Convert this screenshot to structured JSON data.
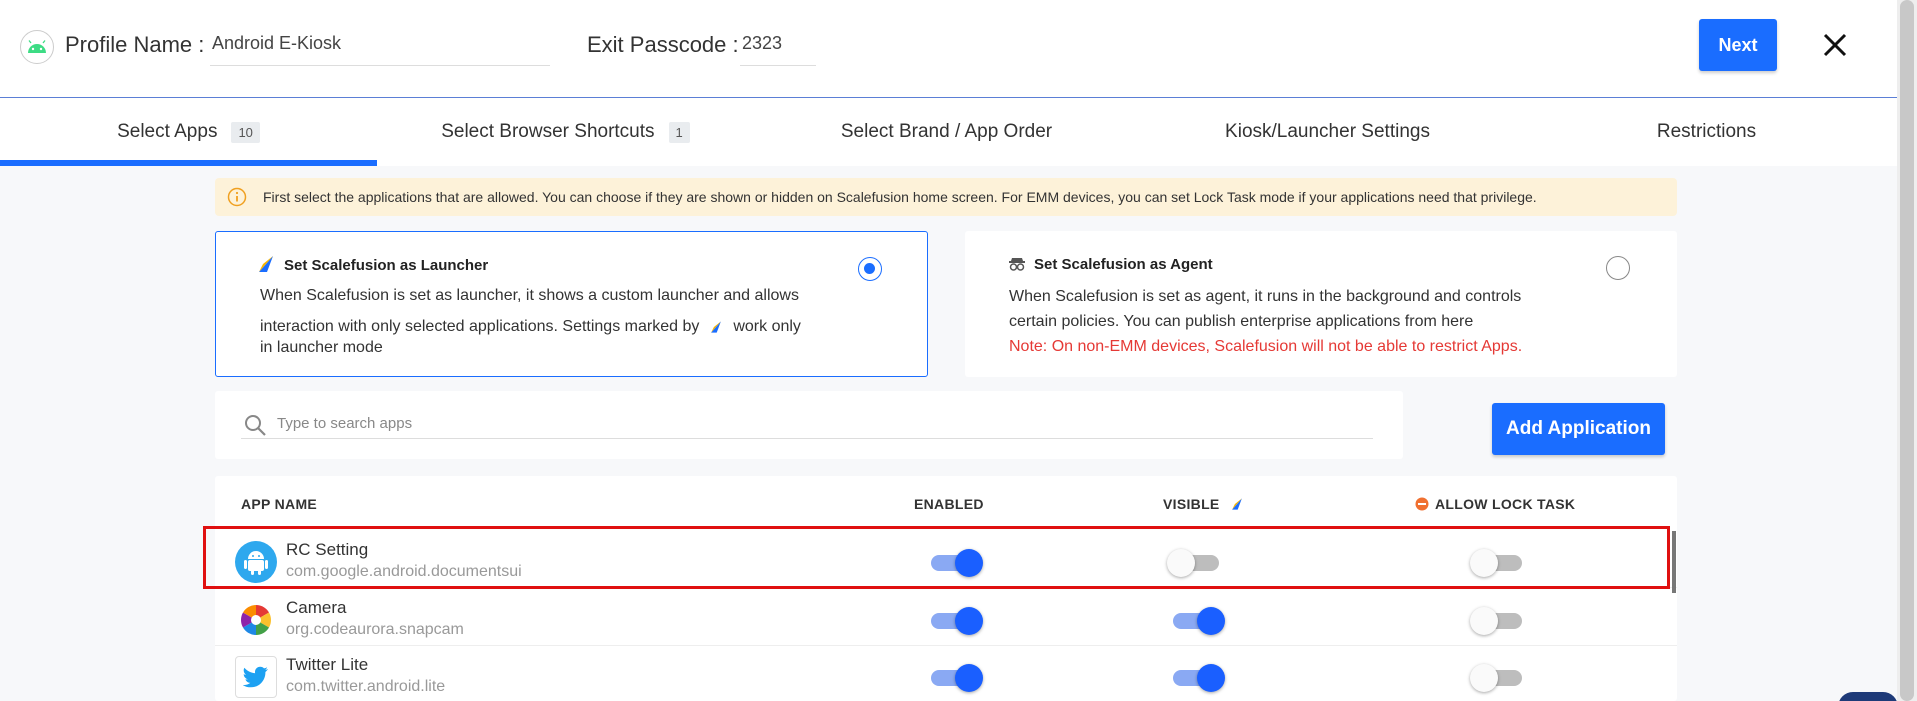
{
  "header": {
    "profile_label": "Profile Name",
    "profile_value": "Android E-Kiosk",
    "passcode_label": "Exit Passcode",
    "passcode_value": "2323",
    "next_label": "Next"
  },
  "tabs": [
    {
      "label": "Select Apps",
      "count": "10"
    },
    {
      "label": "Select Browser Shortcuts",
      "count": "1"
    },
    {
      "label": "Select Brand / App Order"
    },
    {
      "label": "Kiosk/Launcher Settings"
    },
    {
      "label": "Restrictions"
    }
  ],
  "info": "First select the applications that are allowed. You can choose if they are shown or hidden on Scalefusion home screen. For EMM devices, you can set Lock Task mode if your applications need that privilege.",
  "launcher_card": {
    "title": "Set Scalefusion as Launcher",
    "line1": "When Scalefusion is set as launcher, it shows a custom launcher and allows",
    "line2a": "interaction with only selected applications. Settings marked by",
    "line2b": "work only",
    "line3": "in launcher mode",
    "selected": true
  },
  "agent_card": {
    "title": "Set Scalefusion as Agent",
    "line1": "When Scalefusion is set as agent, it runs in the background and controls",
    "line2": "certain policies. You can publish enterprise applications from here",
    "note": "Note: On non-EMM devices, Scalefusion will not be able to restrict Apps.",
    "selected": false
  },
  "search": {
    "placeholder": "Type to search apps"
  },
  "add_application_label": "Add Application",
  "table": {
    "columns": {
      "app": "APP NAME",
      "enabled": "ENABLED",
      "visible": "VISIBLE",
      "lock": "ALLOW LOCK TASK"
    },
    "rows": [
      {
        "name": "RC Setting",
        "package": "com.google.android.documentsui",
        "enabled": true,
        "visible": false,
        "lock": false,
        "icon": "android-icon"
      },
      {
        "name": "Camera",
        "package": "org.codeaurora.snapcam",
        "enabled": true,
        "visible": true,
        "lock": false,
        "icon": "camera-icon"
      },
      {
        "name": "Twitter Lite",
        "package": "com.twitter.android.lite",
        "enabled": true,
        "visible": true,
        "lock": false,
        "icon": "twitter-icon"
      }
    ]
  },
  "colors": {
    "accent": "#1a6dff",
    "highlight": "#e01010",
    "warning_bg": "#fdf2d9",
    "note": "#e53935"
  }
}
